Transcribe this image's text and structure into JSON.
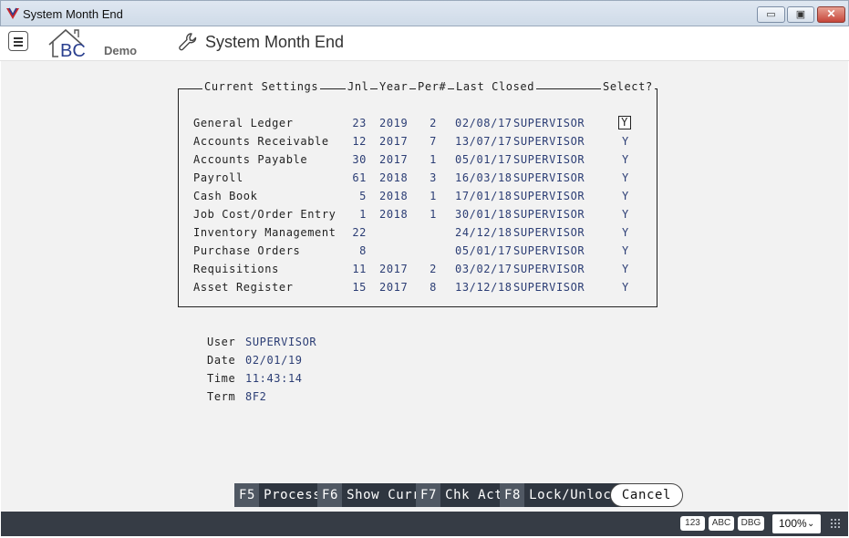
{
  "window": {
    "title": "System Month End"
  },
  "header": {
    "logo_text": "BC",
    "logo_sub": "Demo",
    "page_title": "System Month End"
  },
  "panel": {
    "label_settings": "Current Settings",
    "label_jnl": "Jnl",
    "label_year": "Year",
    "label_per": "Per#",
    "label_last_closed": "Last Closed",
    "label_select": "Select?",
    "rows": [
      {
        "name": "General Ledger",
        "jnl": "23",
        "year": "2019",
        "per": "2",
        "date": "02/08/17",
        "user": "SUPERVISOR",
        "select": "Y"
      },
      {
        "name": "Accounts Receivable",
        "jnl": "12",
        "year": "2017",
        "per": "7",
        "date": "13/07/17",
        "user": "SUPERVISOR",
        "select": "Y"
      },
      {
        "name": "Accounts Payable",
        "jnl": "30",
        "year": "2017",
        "per": "1",
        "date": "05/01/17",
        "user": "SUPERVISOR",
        "select": "Y"
      },
      {
        "name": "Payroll",
        "jnl": "61",
        "year": "2018",
        "per": "3",
        "date": "16/03/18",
        "user": "SUPERVISOR",
        "select": "Y"
      },
      {
        "name": "Cash Book",
        "jnl": "5",
        "year": "2018",
        "per": "1",
        "date": "17/01/18",
        "user": "SUPERVISOR",
        "select": "Y"
      },
      {
        "name": "Job Cost/Order Entry",
        "jnl": "1",
        "year": "2018",
        "per": "1",
        "date": "30/01/18",
        "user": "SUPERVISOR",
        "select": "Y"
      },
      {
        "name": "Inventory Management",
        "jnl": "22",
        "year": "",
        "per": "",
        "date": "24/12/18",
        "user": "SUPERVISOR",
        "select": "Y"
      },
      {
        "name": "Purchase Orders",
        "jnl": "8",
        "year": "",
        "per": "",
        "date": "05/01/17",
        "user": "SUPERVISOR",
        "select": "Y"
      },
      {
        "name": "Requisitions",
        "jnl": "11",
        "year": "2017",
        "per": "2",
        "date": "03/02/17",
        "user": "SUPERVISOR",
        "select": "Y"
      },
      {
        "name": "Asset Register",
        "jnl": "15",
        "year": "2017",
        "per": "8",
        "date": "13/12/18",
        "user": "SUPERVISOR",
        "select": "Y"
      }
    ]
  },
  "info": {
    "user_label": "User",
    "user_value": "SUPERVISOR",
    "date_label": "Date",
    "date_value": "02/01/19",
    "time_label": "Time",
    "time_value": "11:43:14",
    "term_label": "Term",
    "term_value": "8F2"
  },
  "fkeys": [
    {
      "key": "F5",
      "label": "Process"
    },
    {
      "key": "F6",
      "label": "Show Curr"
    },
    {
      "key": "F7",
      "label": "Chk Act"
    },
    {
      "key": "F8",
      "label": "Lock/Unlock"
    }
  ],
  "cancel_label": "Cancel",
  "statusbar": {
    "badge_num": "123",
    "badge_abc": "ABC",
    "badge_dbg": "DBG",
    "zoom": "100%"
  }
}
